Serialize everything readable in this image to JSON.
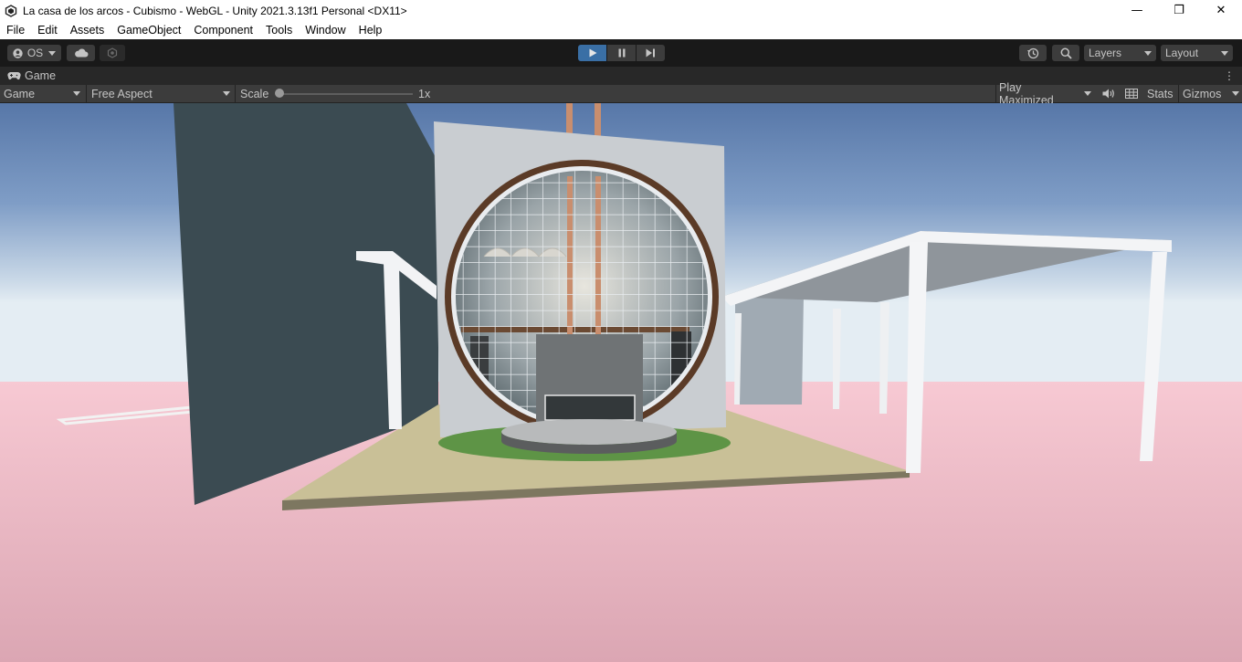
{
  "window": {
    "title": "La casa de los arcos - Cubismo - WebGL - Unity 2021.3.13f1 Personal <DX11>",
    "controls": {
      "minimize": "—",
      "maximize": "❐",
      "close": "✕"
    }
  },
  "menu": [
    "File",
    "Edit",
    "Assets",
    "GameObject",
    "Component",
    "Tools",
    "Window",
    "Help"
  ],
  "toolbar": {
    "account_label": "OS",
    "layers_label": "Layers",
    "layout_label": "Layout",
    "play_state": "playing",
    "accent_color": "#3a6fa5"
  },
  "game_tab": {
    "label": "Game"
  },
  "game_controls": {
    "display": "Game",
    "aspect": "Free Aspect",
    "scale_label": "Scale",
    "scale_value": "1x",
    "play_maximized": "Play Maximized",
    "stats": "Stats",
    "gizmos": "Gizmos"
  },
  "scene": {
    "sky_top_color": "#5777a8",
    "horizon_color": "#dbe6ef",
    "ground_color": "#f0bcc8"
  }
}
